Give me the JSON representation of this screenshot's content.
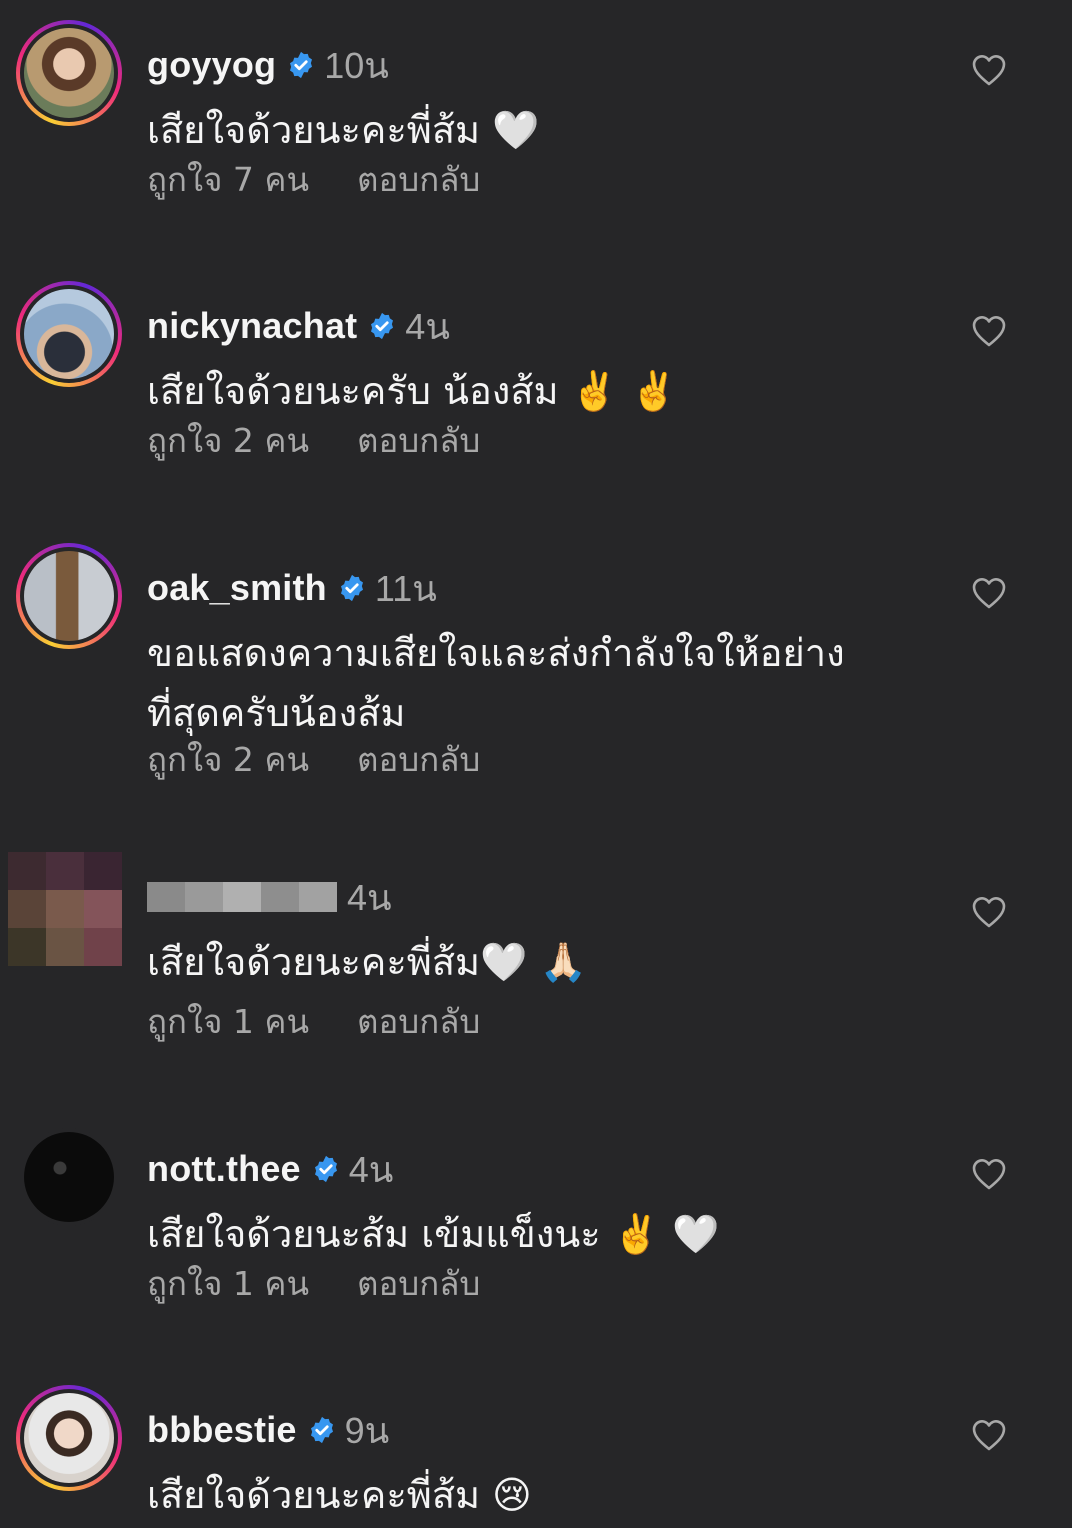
{
  "colors": {
    "background": "#262628",
    "primary_text": "#f5f5f5",
    "secondary_text": "#a8a8a8",
    "verified_badge": "#3897f0"
  },
  "comments": [
    {
      "username": "goyyog",
      "verified": true,
      "time": "10น",
      "text": "เสียใจด้วยนะคะพี่ส้ม 🤍",
      "likes": "ถูกใจ 7 คน",
      "reply": "ตอบกลับ",
      "avatar_icon": "profile-photo"
    },
    {
      "username": "nickynachat",
      "verified": true,
      "time": "4น",
      "text": "เสียใจด้วยนะครับ น้องส้ม ✌️ ✌️",
      "likes": "ถูกใจ 2 คน",
      "reply": "ตอบกลับ",
      "avatar_icon": "profile-photo"
    },
    {
      "username": "oak_smith",
      "verified": true,
      "time": "11น",
      "text": "ขอแสดงความเสียใจและส่งกำลังใจให้อย่างที่สุดครับน้องส้ม",
      "likes": "ถูกใจ 2 คน",
      "reply": "ตอบกลับ",
      "avatar_icon": "profile-photo"
    },
    {
      "username": "",
      "verified": false,
      "time": "4น",
      "text": "เสียใจด้วยนะคะพี่ส้ม🤍 🙏🏻",
      "likes": "ถูกใจ 1 คน",
      "reply": "ตอบกลับ",
      "avatar_icon": "pixelated-avatar"
    },
    {
      "username": "nott.thee",
      "verified": true,
      "time": "4น",
      "text": "เสียใจด้วยนะส้ม เข้มแข็งนะ ✌️ 🤍",
      "likes": "ถูกใจ 1 คน",
      "reply": "ตอบกลับ",
      "avatar_icon": "profile-photo"
    },
    {
      "username": "bbbestie",
      "verified": true,
      "time": "9น",
      "text": "เสียใจด้วยนะคะพี่ส้ม 😢",
      "likes": "",
      "reply": "",
      "avatar_icon": "profile-photo"
    }
  ],
  "icons": {
    "like": "heart-outline-icon",
    "verified": "verified-badge-icon"
  }
}
